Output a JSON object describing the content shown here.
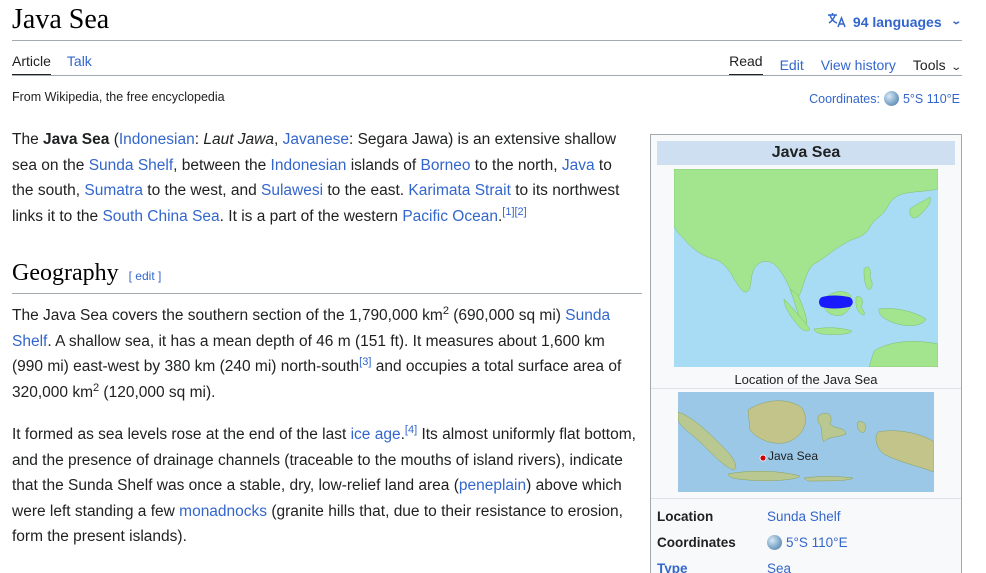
{
  "header": {
    "title": "Java Sea",
    "languages": "94 languages"
  },
  "tabs": {
    "article": "Article",
    "talk": "Talk",
    "read": "Read",
    "edit": "Edit",
    "history": "View history",
    "tools": "Tools"
  },
  "tagline": "From Wikipedia, the free encyclopedia",
  "coords_top": {
    "label": "Coordinates:",
    "value": "5°S 110°E"
  },
  "para1": {
    "t1": "The ",
    "bold": "Java Sea",
    "t2": " (",
    "l_indonesian": "Indonesian",
    "t3": ": ",
    "italic": "Laut Jawa",
    "t4": ", ",
    "l_javanese": "Javanese",
    "t5": ": Segara Jawa) is an extensive shallow sea on the ",
    "l_sunda": "Sunda Shelf",
    "t6": ", between the ",
    "l_indonesian2": "Indonesian",
    "t7": " islands of ",
    "l_borneo": "Borneo",
    "t8": " to the north, ",
    "l_java": "Java",
    "t9": " to the south, ",
    "l_sumatra": "Sumatra",
    "t10": " to the west, and ",
    "l_sulawesi": "Sulawesi",
    "t11": " to the east. ",
    "l_karimata": "Karimata Strait",
    "t12": " to its northwest links it to the ",
    "l_scs": "South China Sea",
    "t13": ". It is a part of the western ",
    "l_pacific": "Pacific Ocean",
    "t14": ".",
    "ref": "[1][2]"
  },
  "geography": {
    "heading": "Geography",
    "edit": "[ edit ]"
  },
  "para2": {
    "t1": "The Java Sea covers the southern section of the 1,790,000 km",
    "sup1": "2",
    "t2": " (690,000 sq mi) ",
    "l_sunda": "Sunda Shelf",
    "t3": ". A shallow sea, it has a mean depth of 46 m (151 ft). It measures about 1,600 km (990 mi) east-west by 380 km (240 mi) north-south",
    "ref": "[3]",
    "t4": " and occupies a total surface area of 320,000 km",
    "sup2": "2",
    "t5": " (120,000 sq mi)."
  },
  "para3": {
    "t1": "It formed as sea levels rose at the end of the last ",
    "l_ice": "ice age",
    "t2": ".",
    "ref": "[4]",
    "t3": " Its almost uniformly flat bottom, and the presence of drainage channels (traceable to the mouths of island rivers), indicate that the Sunda Shelf was once a stable, dry, low-relief land area (",
    "l_peneplain": "peneplain",
    "t4": ") above which were left standing a few ",
    "l_monad": "monadnocks",
    "t5": " (granite hills that, due to their resistance to erosion, form the present islands)."
  },
  "infobox": {
    "title": "Java Sea",
    "caption1": "Location of the Java Sea",
    "map2_label": "Java Sea",
    "rows": [
      {
        "key": "Location",
        "value": "Sunda Shelf"
      },
      {
        "key": "Coordinates",
        "value": "5°S 110°E"
      },
      {
        "key": "Type",
        "value": "Sea"
      }
    ]
  },
  "colors": {
    "link": "#3366cc",
    "infobox_title_bg": "#cedff2",
    "map_sea": "#a8dcf5",
    "map_land": "#a3e48e",
    "highlight_sea": "#1a1aff"
  }
}
